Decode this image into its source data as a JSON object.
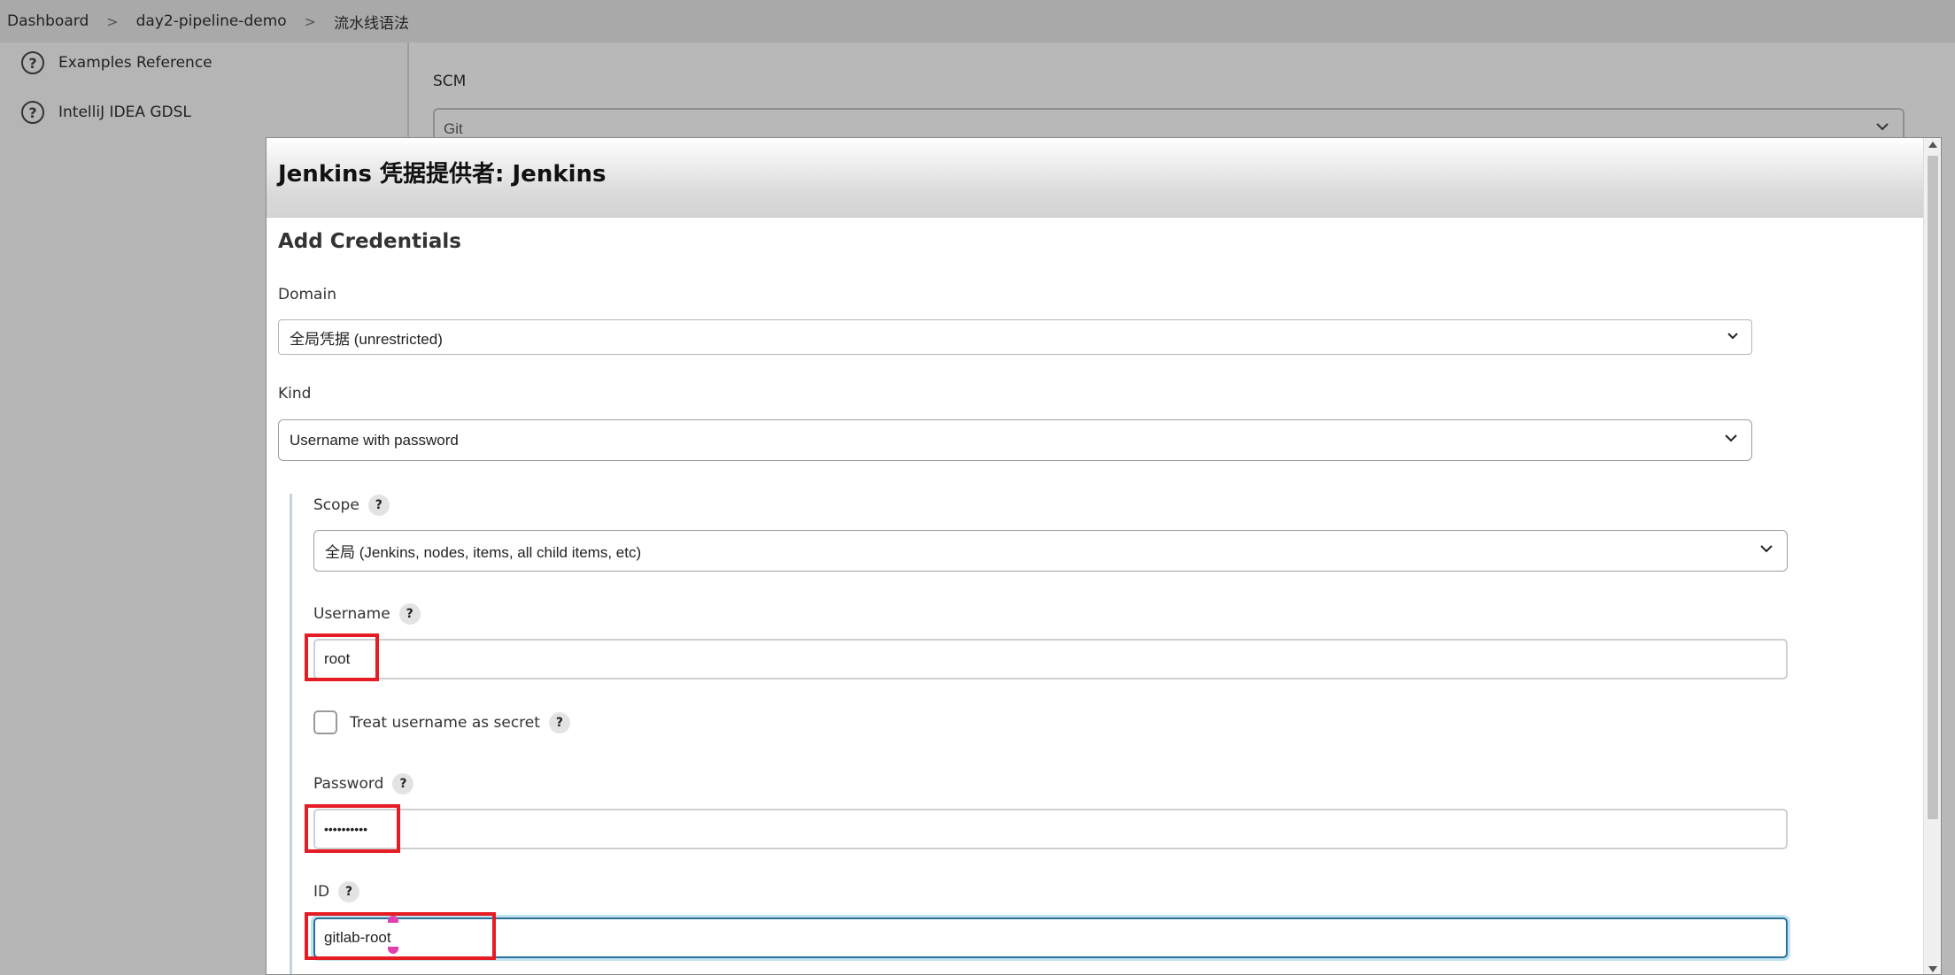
{
  "breadcrumb": {
    "items": [
      "Dashboard",
      "day2-pipeline-demo",
      "流水线语法"
    ],
    "separator": ">"
  },
  "sidebar": {
    "items": [
      {
        "label": "Examples Reference",
        "icon": "help-circle-icon"
      },
      {
        "label": "IntelliJ IDEA GDSL",
        "icon": "help-circle-icon"
      }
    ]
  },
  "background_form": {
    "scm_label": "SCM",
    "scm_value": "Git"
  },
  "dialog": {
    "title": "Jenkins 凭据提供者: Jenkins",
    "section_title": "Add Credentials",
    "domain": {
      "label": "Domain",
      "value": "全局凭据 (unrestricted)"
    },
    "kind": {
      "label": "Kind",
      "value": "Username with password"
    },
    "scope": {
      "label": "Scope",
      "help": "?",
      "value": "全局 (Jenkins, nodes, items, all child items, etc)"
    },
    "username": {
      "label": "Username",
      "help": "?",
      "value": "root"
    },
    "treat_secret": {
      "label": "Treat username as secret",
      "help": "?",
      "checked": false
    },
    "password": {
      "label": "Password",
      "help": "?",
      "value": "••••••••••"
    },
    "id": {
      "label": "ID",
      "help": "?",
      "value": "gitlab-root"
    }
  },
  "colors": {
    "highlight": "#e51c23",
    "focus": "#2a7098",
    "handle": "#e040b0"
  }
}
